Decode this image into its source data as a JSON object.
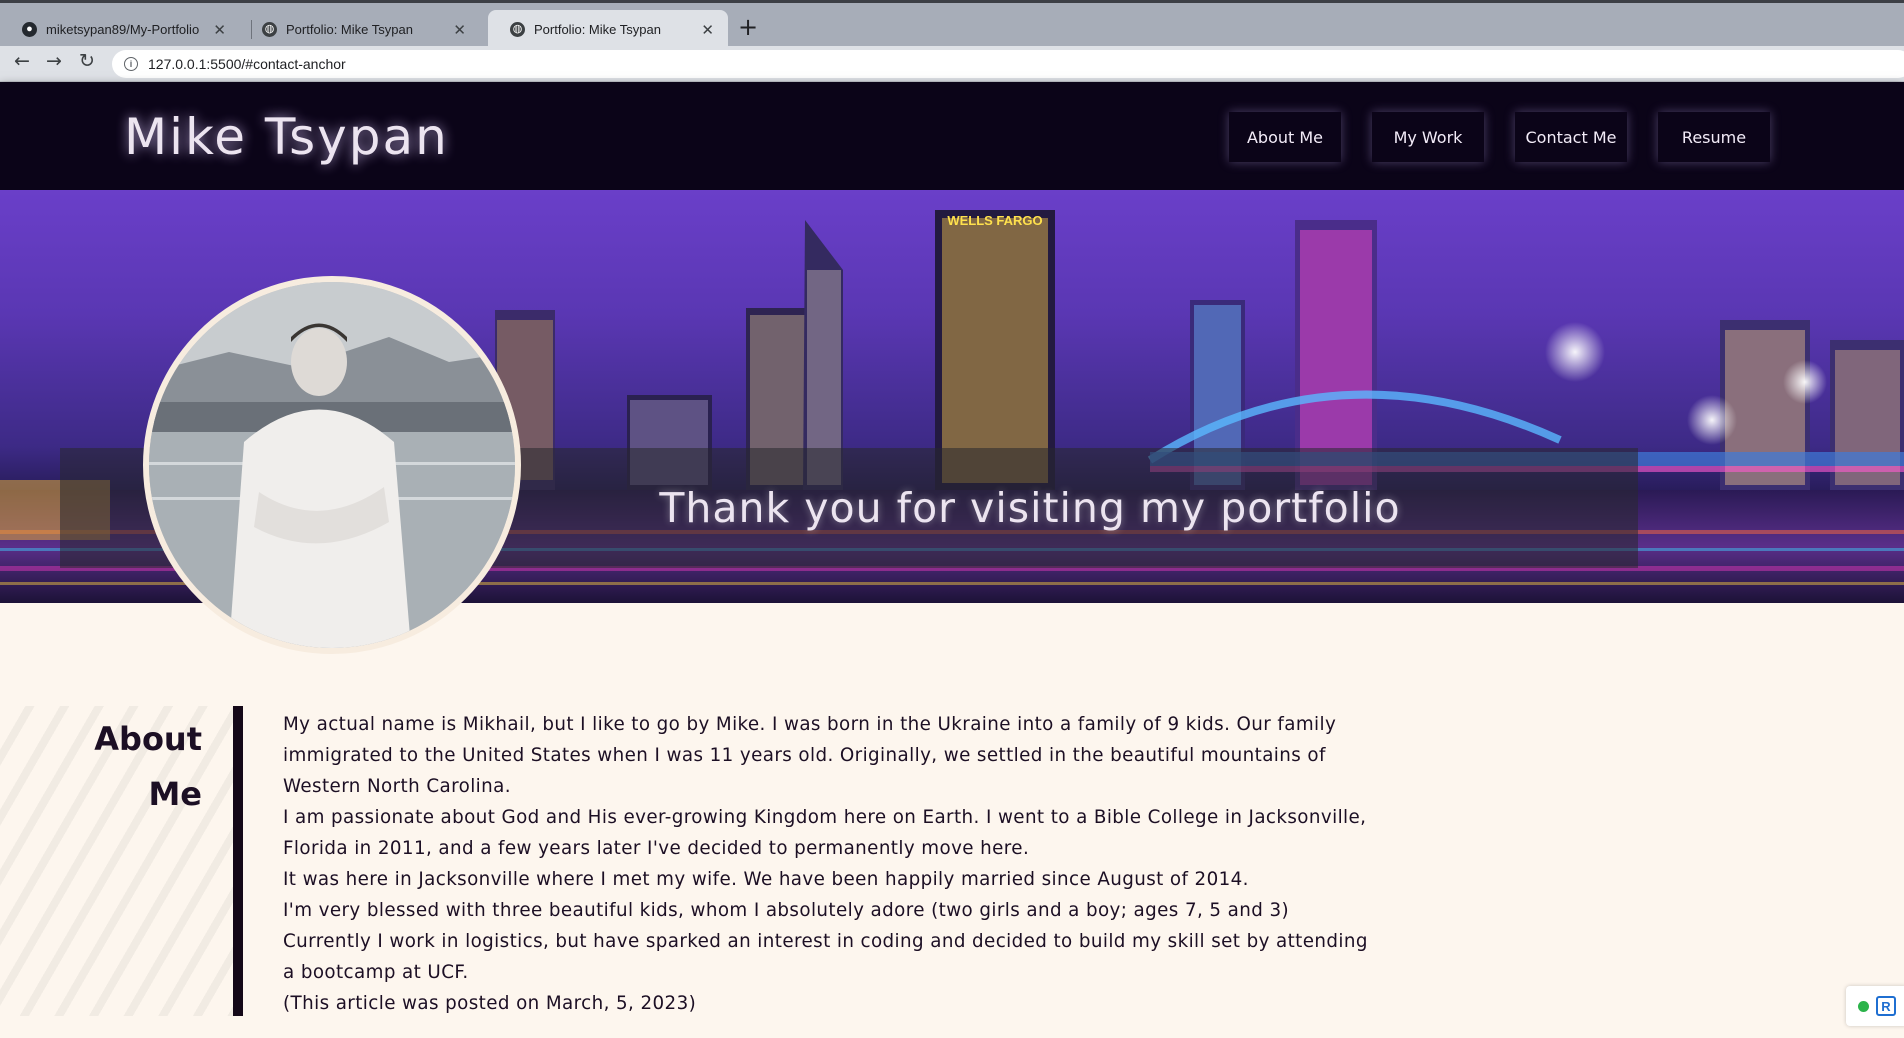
{
  "browser": {
    "tabs": [
      {
        "title": "miketsypan89/My-Portfolio",
        "icon": "github-icon",
        "active": false
      },
      {
        "title": "Portfolio: Mike Tsypan",
        "icon": "globe-icon",
        "active": false
      },
      {
        "title": "Portfolio: Mike Tsypan",
        "icon": "globe-icon",
        "active": true
      }
    ],
    "new_tab": "+",
    "close_glyph": "✕",
    "url": "127.0.0.1:5500/#contact-anchor"
  },
  "header": {
    "title": "Mike Tsypan",
    "nav": [
      {
        "label": "About Me"
      },
      {
        "label": "My Work"
      },
      {
        "label": "Contact Me"
      },
      {
        "label": "Resume"
      }
    ]
  },
  "hero": {
    "banner_text": "Thank you for visiting my portfolio",
    "sign_text": "WELLS FARGO"
  },
  "about": {
    "heading_line1": "About",
    "heading_line2": "Me",
    "lines": [
      "My actual name is Mikhail, but I like to go by Mike. I was born in the Ukraine into a family of 9 kids. Our family",
      "immigrated to the United States when I was 11 years old. Originally, we settled in the beautiful mountains of",
      "Western North Carolina.",
      "I am passionate about God and His ever-growing Kingdom here on Earth. I went to a Bible College in Jacksonville,",
      "Florida in 2011, and a few years later I've decided to permanently move here.",
      "It was here in Jacksonville where I met my wife. We have been happily married since August of 2014.",
      "I'm very blessed with three beautiful kids, whom I absolutely adore (two girls and a boy; ages 7, 5 and 3)",
      "Currently I work in logistics, but have sparked an interest in coding and decided to build my skill set by attending",
      "a bootcamp at UCF.",
      "(This article was posted on March, 5, 2023)"
    ]
  },
  "colors": {
    "header_bg": "#0b0418",
    "page_bg": "#fdf6ee",
    "accent_bar": "#140818"
  }
}
